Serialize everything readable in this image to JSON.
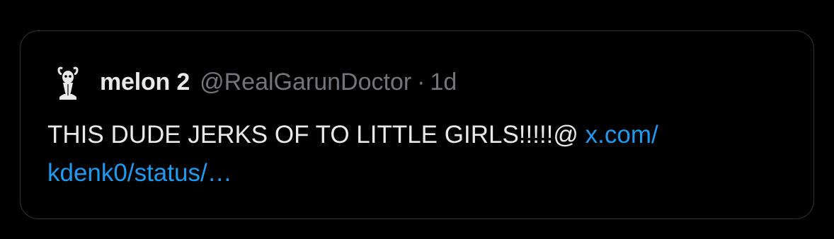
{
  "quoted_tweet": {
    "display_name": "melon 2",
    "handle": "@RealGarunDoctor",
    "separator": "·",
    "timestamp": "1d",
    "avatar_icon": "goat-skull-avatar-icon",
    "text": "THIS DUDE JERKS OF TO LITTLE GIRLS!!!!!@ ",
    "link_line1": "x.com/",
    "link_line2": "kdenk0/status/…"
  },
  "colors": {
    "background": "#000000",
    "border": "#2f3336",
    "primary_text": "#e7e9ea",
    "secondary_text": "#71767b",
    "link": "#1d9bf0"
  }
}
